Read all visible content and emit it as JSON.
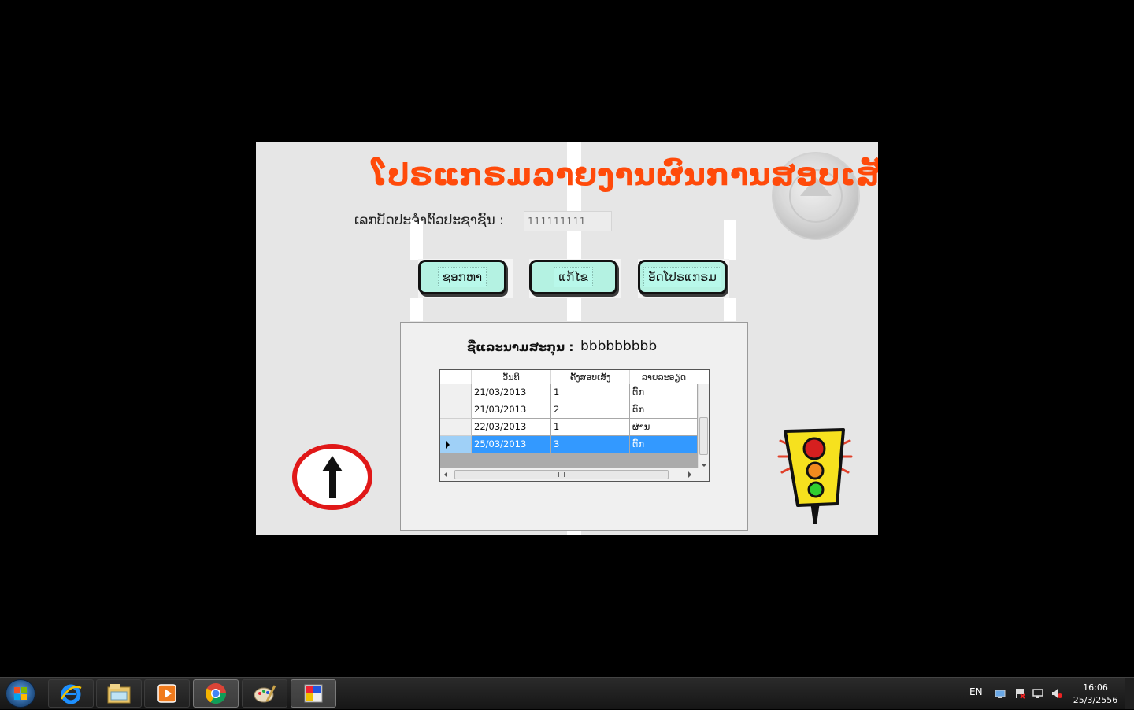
{
  "app": {
    "title": "ໂປຣແກຣມລາຍງານຜົນການສອບເສັງພາກ",
    "id_label": "ເລກບັດປະຈໍາຕົວປະຊາຊົນ :",
    "id_value": "111111111",
    "buttons": {
      "search": "ຊອກຫາ",
      "edit": "ແກ້ໄຂ",
      "close": "ອັດໂປຣແກຣມ"
    },
    "result": {
      "name_label": "ຊື່ແລະນາມສະກຸນ :",
      "name_value": "bbbbbbbbb"
    },
    "grid": {
      "columns": [
        "ວັນທີ",
        "ຄັ້ງສອບເສັງ",
        "ລາຍລະອຽດ"
      ],
      "rows": [
        {
          "date": "21/03/2013",
          "attempt": "1",
          "detail": "ຕົກ"
        },
        {
          "date": "21/03/2013",
          "attempt": "2",
          "detail": "ຕົກ"
        },
        {
          "date": "22/03/2013",
          "attempt": "1",
          "detail": "ຜ່ານ"
        },
        {
          "date": "25/03/2013",
          "attempt": "3",
          "detail": "ຕົກ"
        }
      ],
      "selected_row": 3
    }
  },
  "taskbar": {
    "apps": [
      "windows-explorer-icon",
      "internet-explorer-icon",
      "media-player-icon",
      "chrome-icon",
      "paint-icon",
      "app-form-icon"
    ],
    "language": "EN",
    "time": "16:06",
    "date": "25/3/2556"
  },
  "colors": {
    "title": "#ff4a0a",
    "button_fill": "#b4f2e2",
    "selection": "#3399ff"
  }
}
